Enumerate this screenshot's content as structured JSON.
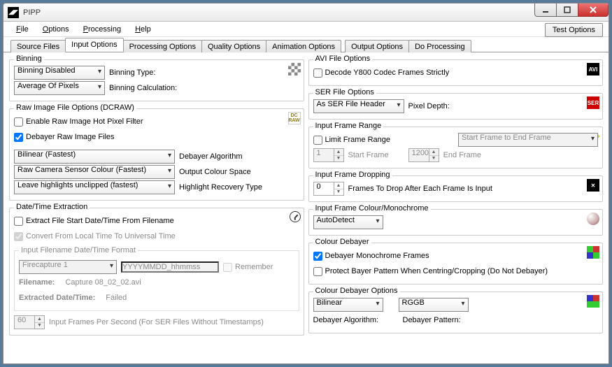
{
  "window": {
    "title": "PIPP"
  },
  "menu": {
    "file": "File",
    "options": "Options",
    "processing": "Processing",
    "help": "Help",
    "test_options": "Test Options"
  },
  "tabs": {
    "source": "Source Files",
    "input": "Input Options",
    "processing": "Processing Options",
    "quality": "Quality Options",
    "animation": "Animation Options",
    "output": "Output Options",
    "do": "Do Processing"
  },
  "binning": {
    "legend": "Binning",
    "mode": "Binning Disabled",
    "mode_label": "Binning Type:",
    "calc": "Average Of Pixels",
    "calc_label": "Binning Calculation:"
  },
  "dcraw": {
    "legend": "Raw Image File Options (DCRAW)",
    "hotpixel": "Enable Raw Image Hot Pixel Filter",
    "debayer": "Debayer Raw Image Files",
    "algo": "Bilinear (Fastest)",
    "algo_label": "Debayer Algorithm",
    "space": "Raw Camera Sensor Colour (Fastest)",
    "space_label": "Output Colour Space",
    "highlight": "Leave highlights unclipped (fastest)",
    "highlight_label": "Highlight Recovery Type"
  },
  "datetime": {
    "legend": "Date/Time Extraction",
    "extract": "Extract File Start Date/Time From Filename",
    "convert": "Convert From Local Time To Universal Time",
    "fmt_legend": "Input Filename Date/Time Format",
    "preset": "Firecapture 1",
    "pattern": "YYYYMMDD_hhmmss",
    "remember": "Remember",
    "filename_label": "Filename:",
    "filename_val": "Capture 08_02_02.avi",
    "extracted_label": "Extracted Date/Time:",
    "extracted_val": "Failed",
    "fps": "60",
    "fps_label": "Input Frames Per Second (For SER Files Without Timestamps)"
  },
  "avi": {
    "legend": "AVI File Options",
    "strict": "Decode Y800 Codec Frames Strictly"
  },
  "ser": {
    "legend": "SER File Options",
    "depth": "As SER File Header",
    "depth_label": "Pixel Depth:"
  },
  "range": {
    "legend": "Input Frame Range",
    "limit": "Limit Frame Range",
    "range_combo": "Start Frame to End Frame",
    "start": "1",
    "start_label": "Start Frame",
    "end": "1200",
    "end_label": "End Frame"
  },
  "dropping": {
    "legend": "Input Frame Dropping",
    "n": "0",
    "label": "Frames To Drop After Each Frame Is Input"
  },
  "mono": {
    "legend": "Input Frame Colour/Monochrome",
    "mode": "AutoDetect"
  },
  "cdebayer": {
    "legend": "Colour Debayer",
    "mono": "Debayer Monochrome Frames",
    "protect": "Protect Bayer Pattern When Centring/Cropping (Do Not Debayer)"
  },
  "cdopts": {
    "legend": "Colour Debayer Options",
    "algo": "Bilinear",
    "pattern": "RGGB",
    "algo_label": "Debayer Algorithm:",
    "pattern_label": "Debayer Pattern:"
  }
}
